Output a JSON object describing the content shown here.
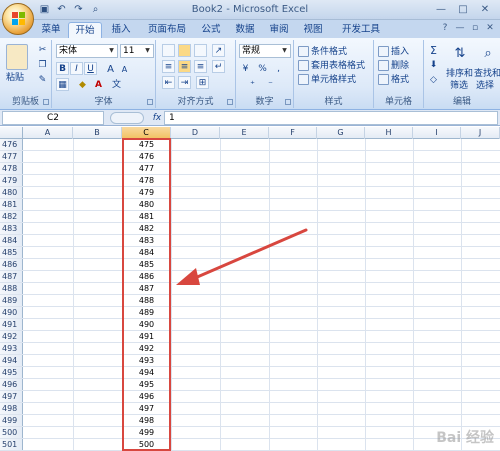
{
  "app": {
    "title": "Book2 - Microsoft Excel",
    "quick_access": [
      "save-icon",
      "undo-icon",
      "redo-icon",
      "print-preview-icon"
    ],
    "window_controls": [
      "minimize-icon",
      "maximize-icon",
      "close-icon"
    ]
  },
  "ribbon_tabs": [
    "菜单",
    "开始",
    "插入",
    "页面布局",
    "公式",
    "数据",
    "审阅",
    "视图",
    "开发工具"
  ],
  "active_tab": "开始",
  "ribbon": {
    "clipboard": {
      "paste": "粘贴",
      "label": "剪贴板"
    },
    "font": {
      "name": "宋体",
      "size": "11",
      "label": "字体",
      "bold": "B",
      "italic": "I",
      "underline": "U",
      "grow": "A",
      "shrink": "A",
      "color_glyph": "A",
      "phonetic": "文"
    },
    "alignment": {
      "label": "对齐方式"
    },
    "number": {
      "format": "常规",
      "label": "数字",
      "percent": "%",
      "comma": ",",
      "currency": "¥"
    },
    "styles": {
      "conditional": "条件格式",
      "table": "套用表格格式",
      "cell": "单元格样式",
      "label": "样式"
    },
    "cells": {
      "insert": "插入",
      "delete": "删除",
      "format": "格式",
      "label": "单元格"
    },
    "editing": {
      "sort": "排序和",
      "filter": "筛选",
      "find": "查找和",
      "select": "选择",
      "label": "编辑",
      "sigma": "Σ"
    }
  },
  "formula_bar": {
    "cell_ref": "C2",
    "fx": "fx",
    "value": "1"
  },
  "columns": [
    "A",
    "B",
    "C",
    "D",
    "E",
    "F",
    "G",
    "H",
    "I",
    "J"
  ],
  "selected_column": "C",
  "rows": [
    {
      "row": "476",
      "c": "475"
    },
    {
      "row": "477",
      "c": "476"
    },
    {
      "row": "478",
      "c": "477"
    },
    {
      "row": "479",
      "c": "478"
    },
    {
      "row": "480",
      "c": "479"
    },
    {
      "row": "481",
      "c": "480"
    },
    {
      "row": "482",
      "c": "481"
    },
    {
      "row": "483",
      "c": "482"
    },
    {
      "row": "484",
      "c": "483"
    },
    {
      "row": "485",
      "c": "484"
    },
    {
      "row": "486",
      "c": "485"
    },
    {
      "row": "487",
      "c": "486"
    },
    {
      "row": "488",
      "c": "487"
    },
    {
      "row": "489",
      "c": "488"
    },
    {
      "row": "490",
      "c": "489"
    },
    {
      "row": "491",
      "c": "490"
    },
    {
      "row": "492",
      "c": "491"
    },
    {
      "row": "493",
      "c": "492"
    },
    {
      "row": "494",
      "c": "493"
    },
    {
      "row": "495",
      "c": "494"
    },
    {
      "row": "496",
      "c": "495"
    },
    {
      "row": "497",
      "c": "496"
    },
    {
      "row": "498",
      "c": "497"
    },
    {
      "row": "499",
      "c": "498"
    },
    {
      "row": "500",
      "c": "499"
    },
    {
      "row": "501",
      "c": "500"
    }
  ],
  "annotation": {
    "color": "#d8473f"
  },
  "watermark": "Bai 经验"
}
